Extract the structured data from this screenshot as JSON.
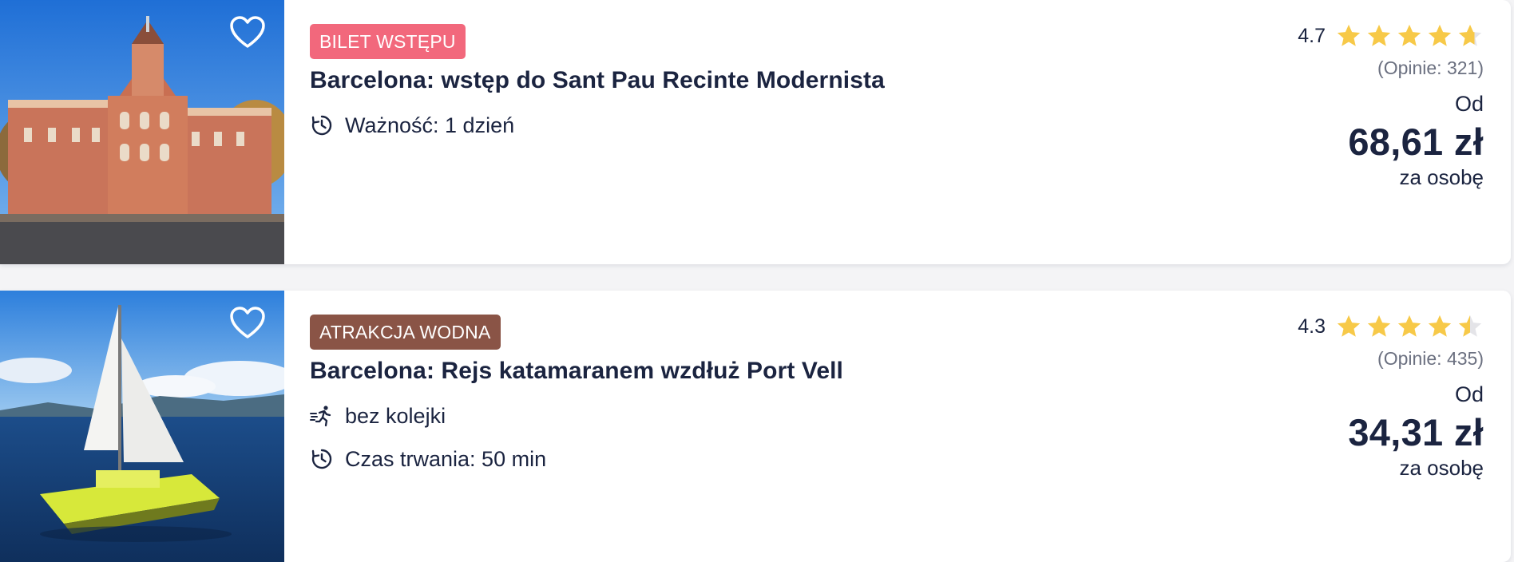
{
  "listings": [
    {
      "badge": "BILET WSTĘPU",
      "badge_color": "#f2687c",
      "title": "Barcelona: wstęp do Sant Pau Recinte Modernista",
      "features": [
        {
          "icon": "clock-icon",
          "text": "Ważność: 1 dzień"
        }
      ],
      "rating": "4.7",
      "rating_fraction": 0.7,
      "reviews": "(Opinie: 321)",
      "from_label": "Od",
      "price": "68,61 zł",
      "per_label": "za osobę",
      "image": "sant-pau-building-photo"
    },
    {
      "badge": "ATRAKCJA WODNA",
      "badge_color": "#8a5446",
      "title": "Barcelona: Rejs katamaranem wzdłuż Port Vell",
      "features": [
        {
          "icon": "skip-line-icon",
          "text": "bez kolejki"
        },
        {
          "icon": "clock-icon",
          "text": "Czas trwania: 50 min"
        }
      ],
      "rating": "4.3",
      "rating_fraction": 0.5,
      "reviews": "(Opinie: 435)",
      "from_label": "Od",
      "price": "34,31 zł",
      "per_label": "za osobę",
      "image": "catamaran-photo"
    }
  ],
  "colors": {
    "star": "#f7c948",
    "star_empty": "#e4e4e8",
    "text": "#1b2440",
    "muted": "#6b7080"
  }
}
